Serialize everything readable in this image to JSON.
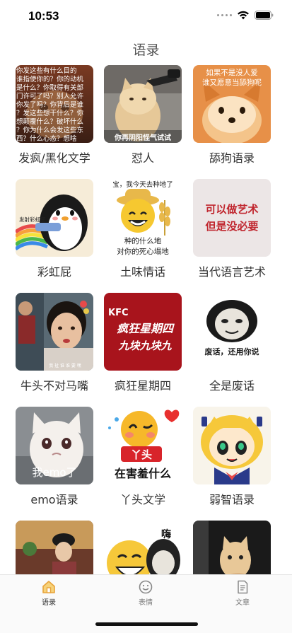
{
  "status": {
    "time": "10:53"
  },
  "nav": {
    "title": "语录"
  },
  "grid": {
    "items": [
      {
        "label": "发疯/黑化文学",
        "overlay_lines": [
          "你发这些有什么目的",
          "谁指使你的？你的动机",
          "是什么？你取得有关部",
          "门许可了吗？别人允许",
          "你发了吗？你背后是谁",
          "？发这些想干什么？你",
          "想颠覆什么？破坏什么",
          "？你为什么会发这些东",
          "西？什么心态？想啥"
        ]
      },
      {
        "label": "怼人",
        "overlay_lines": [
          "你再阴阳怪气试试"
        ]
      },
      {
        "label": "舔狗语录",
        "overlay_lines": [
          "如果不是没人爱",
          "谁又愿意当舔狗呢"
        ]
      },
      {
        "label": "彩虹屁",
        "overlay_lines": [
          "发射彩虹屁"
        ]
      },
      {
        "label": "土味情话",
        "overlay_lines": [
          "宝，我今天去种地了",
          "种的什么地",
          "对你的死心塌地"
        ]
      },
      {
        "label": "当代语言艺术",
        "overlay_lines": [
          "可以做艺术",
          "但是没必要"
        ]
      },
      {
        "label": "牛头不对马嘴",
        "overlay_lines": [
          "我 扯 谁 谁 要 嘿"
        ]
      },
      {
        "label": "疯狂星期四",
        "overlay_lines": [
          "KFC",
          "疯狂星期四",
          "九块九块九"
        ]
      },
      {
        "label": "全是废话",
        "overlay_lines": [
          "废话，还用你说"
        ]
      },
      {
        "label": "emo语录",
        "overlay_lines": [
          "我emo了"
        ]
      },
      {
        "label": "丫头文学",
        "overlay_lines": [
          "丫头",
          "在害羞什么"
        ]
      },
      {
        "label": "弱智语录",
        "overlay_lines": []
      },
      {
        "label": "",
        "overlay_lines": []
      },
      {
        "label": "",
        "overlay_lines": [
          "嗨"
        ]
      },
      {
        "label": "",
        "overlay_lines": []
      }
    ]
  },
  "tabs": [
    {
      "label": "语录",
      "icon": "home-icon",
      "active": true
    },
    {
      "label": "表情",
      "icon": "smiley-icon",
      "active": false
    },
    {
      "label": "文章",
      "icon": "document-icon",
      "active": false
    }
  ],
  "colors": {
    "accent_active": "#e8a33a",
    "inactive_icon": "#999999",
    "kfc_red": "#a8141c"
  }
}
